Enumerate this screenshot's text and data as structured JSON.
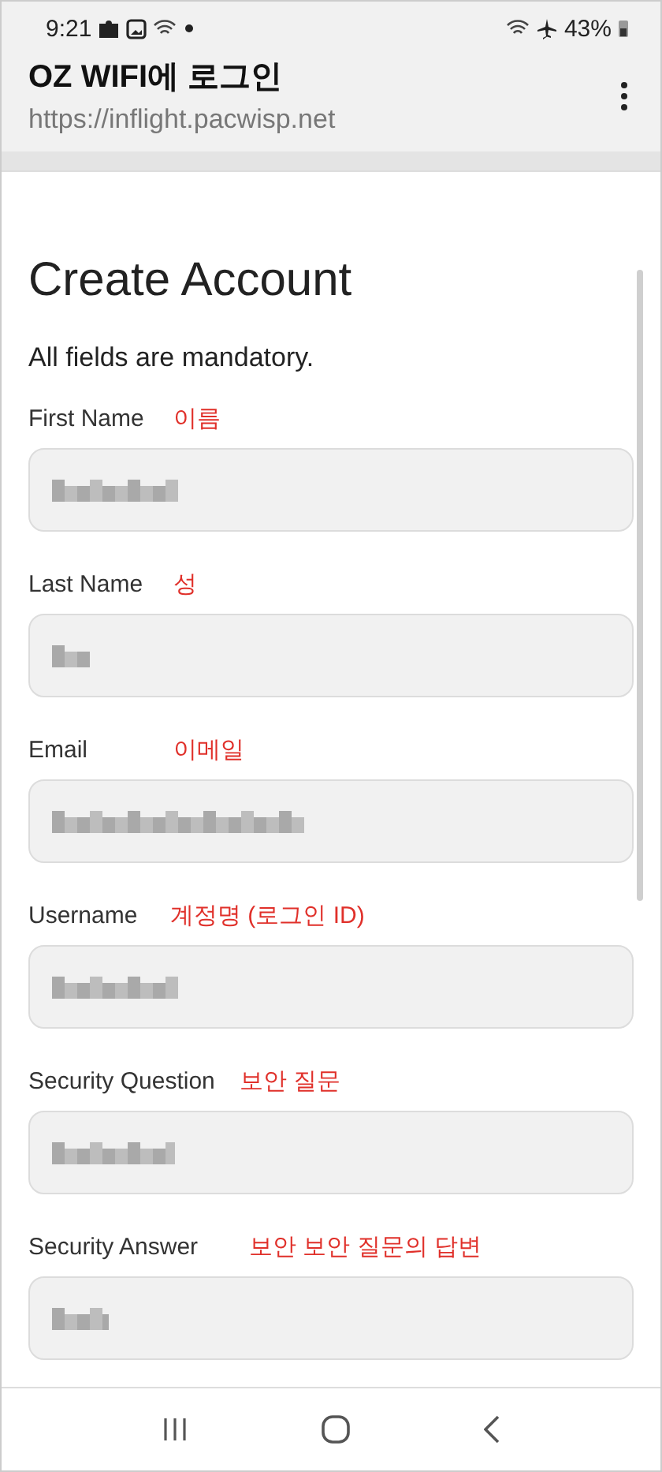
{
  "status_bar": {
    "time": "9:21",
    "battery": "43%"
  },
  "header": {
    "title": "OZ WIFI에 로그인",
    "url": "https://inflight.pacwisp.net"
  },
  "form": {
    "title": "Create Account",
    "note": "All fields are mandatory.",
    "fields": [
      {
        "label": "First Name",
        "annotation": "이름"
      },
      {
        "label": "Last Name",
        "annotation": "성"
      },
      {
        "label": "Email",
        "annotation": "이메일"
      },
      {
        "label": "Username",
        "annotation": "계정명 (로그인 ID)"
      },
      {
        "label": "Security Question",
        "annotation": "보안 질문"
      },
      {
        "label": "Security Answer",
        "annotation": "보안 보안 질문의 답변"
      }
    ]
  }
}
